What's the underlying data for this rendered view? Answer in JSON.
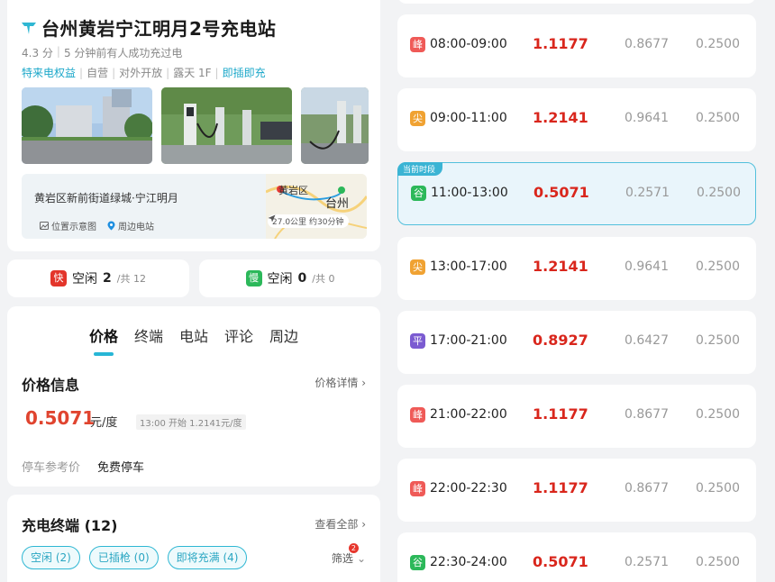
{
  "station": {
    "name": "台州黄岩宁江明月2号充电站",
    "rating": "4.3 分",
    "recent": "5 分钟前有人成功充过电",
    "tags": [
      "特来电权益",
      "自营",
      "对外开放",
      "露天 1F",
      "即插即充"
    ],
    "address": "黄岩区新前街道绿城·宁江明月",
    "map_links": {
      "location": "位置示意图",
      "nearby": "周边电站"
    },
    "map": {
      "place_a": "黄岩区",
      "place_b": "台州",
      "distance": "27.0公里",
      "duration": "约30分钟"
    }
  },
  "status": {
    "fast": {
      "badge": "快",
      "label": "空闲",
      "free": "2",
      "total": "/共 12"
    },
    "slow": {
      "badge": "慢",
      "label": "空闲",
      "free": "0",
      "total": "/共 0"
    }
  },
  "tabs": [
    "价格",
    "终端",
    "电站",
    "评论",
    "周边"
  ],
  "price_info": {
    "title": "价格信息",
    "detail_link": "价格详情",
    "current_price": "0.5071",
    "unit": "元/度",
    "next_note": "13:00 开始 1.2141元/度",
    "parking_label": "停车参考价",
    "parking_value": "免费停车"
  },
  "terminals": {
    "title": "充电终端 (12)",
    "view_all": "查看全部",
    "chips": [
      "空闲 (2)",
      "已插枪 (0)",
      "即将充满 (4)"
    ],
    "filter_label": "筛选",
    "filter_count": "2"
  },
  "periods": [
    {
      "badge": "峰",
      "color": "#ef5a57",
      "time": "08:00-09:00",
      "total": "1.1177",
      "elec": "0.8677",
      "svc": "0.2500",
      "current": false
    },
    {
      "badge": "尖",
      "color": "#f0a232",
      "time": "09:00-11:00",
      "total": "1.2141",
      "elec": "0.9641",
      "svc": "0.2500",
      "current": false
    },
    {
      "badge": "谷",
      "color": "#2cb85a",
      "time": "11:00-13:00",
      "total": "0.5071",
      "elec": "0.2571",
      "svc": "0.2500",
      "current": true,
      "current_label": "当前时段"
    },
    {
      "badge": "尖",
      "color": "#f0a232",
      "time": "13:00-17:00",
      "total": "1.2141",
      "elec": "0.9641",
      "svc": "0.2500",
      "current": false
    },
    {
      "badge": "平",
      "color": "#7b5bd1",
      "time": "17:00-21:00",
      "total": "0.8927",
      "elec": "0.6427",
      "svc": "0.2500",
      "current": false
    },
    {
      "badge": "峰",
      "color": "#ef5a57",
      "time": "21:00-22:00",
      "total": "1.1177",
      "elec": "0.8677",
      "svc": "0.2500",
      "current": false
    },
    {
      "badge": "峰",
      "color": "#ef5a57",
      "time": "22:00-22:30",
      "total": "1.1177",
      "elec": "0.8677",
      "svc": "0.2500",
      "current": false
    },
    {
      "badge": "谷",
      "color": "#2cb85a",
      "time": "22:30-24:00",
      "total": "0.5071",
      "elec": "0.2571",
      "svc": "0.2500",
      "current": false
    }
  ]
}
